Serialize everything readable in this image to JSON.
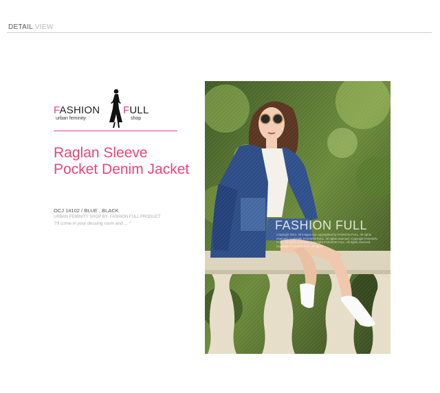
{
  "header": {
    "primary": "DETAIL",
    "secondary": "VIEW"
  },
  "brand": {
    "logo_left_initial": "F",
    "logo_left_rest": "ASHION",
    "logo_right_initial": "F",
    "logo_right_rest": "ULL",
    "tagline_left": "urban feminity",
    "tagline_right": "shop",
    "accent_color": "#e8457a"
  },
  "product": {
    "title": "Raglan Sleeve Pocket Denim Jacket",
    "code_line": "OCJ 14102 / BLUE , BLACK",
    "shop_line": "URBAN FEMINITY SHOP BY- FASHION FULL PRODUCT",
    "quote": "\"I'll come in your dessing room and ... \""
  },
  "photo": {
    "watermark_title": "FASHION FULL",
    "watermark_text": "Copyright 2014. All images are copyrighted by FASHION FULL. All rights reserved. Copyright FASHION FULL. All rights reserved. Copyright FASHION FULL. All rights reserved. Copyright FASHION FULL. All rights reserved. Copyright FASHION FULL all rights"
  }
}
